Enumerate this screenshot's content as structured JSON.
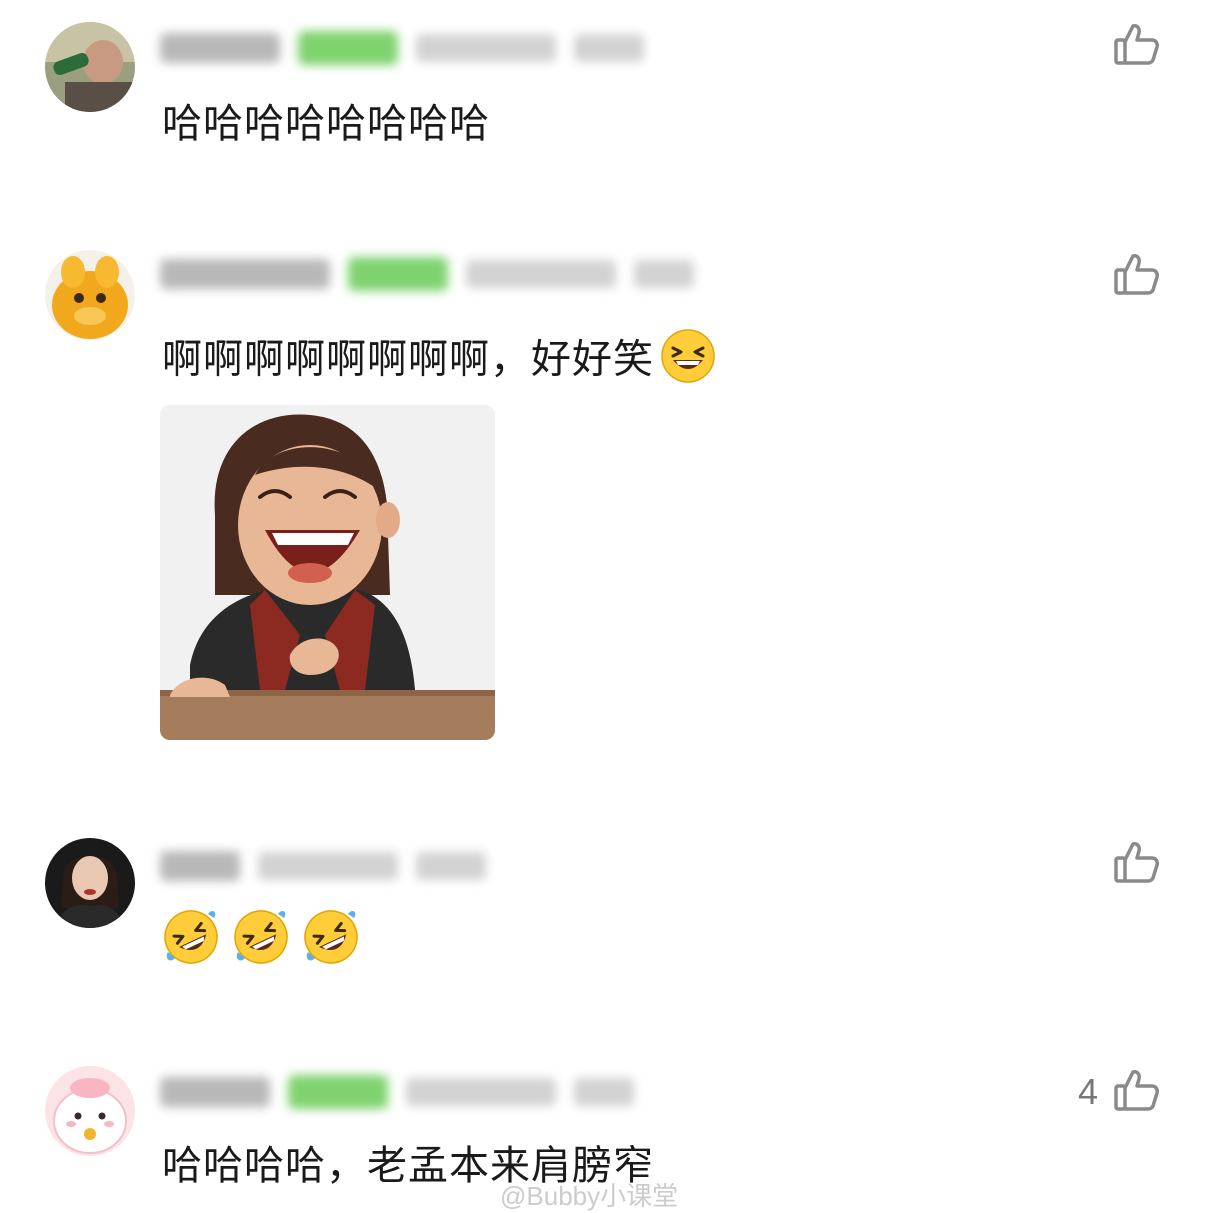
{
  "comments": [
    {
      "text": "哈哈哈哈哈哈哈哈",
      "like_count": ""
    },
    {
      "text": "啊啊啊啊啊啊啊啊，好好笑",
      "like_count": ""
    },
    {
      "text": "",
      "like_count": ""
    },
    {
      "text": "哈哈哈哈，老孟本来肩膀窄",
      "like_count": "4"
    }
  ],
  "icons": {
    "like": "thumbs-up-icon",
    "laugh_emoji": "grinning-squinting-face",
    "rofl_emoji": "rolling-on-floor-laughing-face"
  },
  "colors": {
    "badge_green": "#7fd36f",
    "icon_gray": "#8a8a8a",
    "emoji_yellow": "#ffcc3a"
  },
  "watermark": "@Bubby小课堂"
}
